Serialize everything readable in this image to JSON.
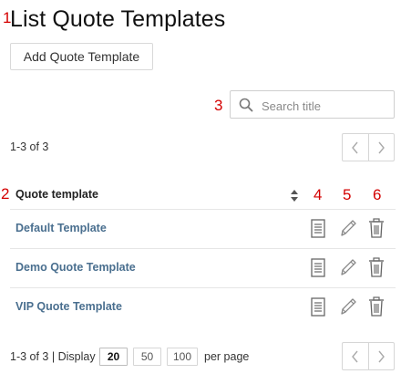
{
  "page": {
    "title": "List Quote Templates",
    "add_button_label": "Add Quote Template"
  },
  "markers": {
    "m1": "1",
    "m2": "2",
    "m3": "3",
    "m4": "4",
    "m5": "5",
    "m6": "6"
  },
  "search": {
    "placeholder": "Search title",
    "value": ""
  },
  "top_count": "1-3 of 3",
  "table": {
    "column_header": "Quote template",
    "rows": [
      {
        "name": "Default Template"
      },
      {
        "name": "Demo Quote Template"
      },
      {
        "name": "VIP Quote Template"
      }
    ]
  },
  "footer": {
    "count_text": "1-3 of 3 | Display",
    "page_sizes": [
      "20",
      "50",
      "100"
    ],
    "selected_page_size": "20",
    "per_page_label": "per page"
  },
  "icons": {
    "search": "search-icon",
    "sort": "sort-icon",
    "view": "document-icon",
    "edit": "pencil-icon",
    "delete": "trash-icon",
    "prev": "chevron-left-icon",
    "next": "chevron-right-icon"
  },
  "colors": {
    "marker": "#d40000",
    "link": "#4a6f8f"
  }
}
